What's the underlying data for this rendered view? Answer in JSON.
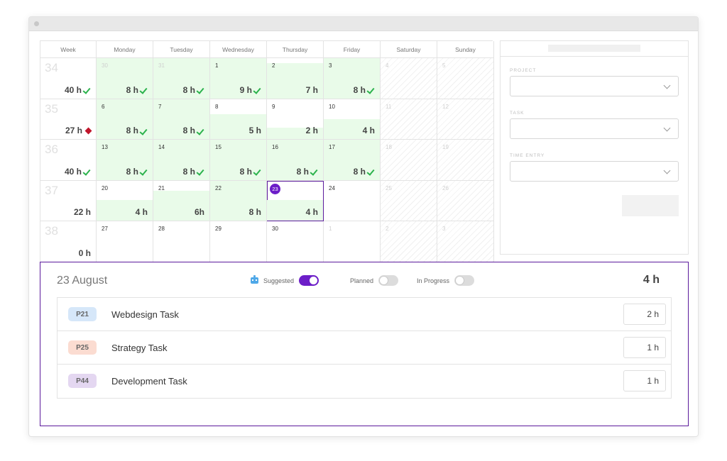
{
  "calendar": {
    "headers": [
      "Week",
      "Monday",
      "Tuesday",
      "Wednesday",
      "Thursday",
      "Friday",
      "Saturday",
      "Sunday"
    ],
    "weeks": [
      {
        "week": "34",
        "total": "40 h",
        "status": "ok",
        "days": [
          {
            "day": "30",
            "hours": "8 h",
            "check": true,
            "fill": 1.0,
            "faded": true
          },
          {
            "day": "31",
            "hours": "8 h",
            "check": true,
            "fill": 1.0,
            "faded": true
          },
          {
            "day": "1",
            "hours": "9 h",
            "check": true,
            "fill": 1.0
          },
          {
            "day": "2",
            "hours": "7 h",
            "check": false,
            "fill": 0.88
          },
          {
            "day": "3",
            "hours": "8 h",
            "check": true,
            "fill": 1.0
          },
          {
            "day": "4",
            "weekend": true,
            "faded": true
          },
          {
            "day": "5",
            "weekend": true,
            "faded": true
          }
        ]
      },
      {
        "week": "35",
        "total": "27 h",
        "status": "warn",
        "days": [
          {
            "day": "6",
            "hours": "8 h",
            "check": true,
            "fill": 1.0
          },
          {
            "day": "7",
            "hours": "8 h",
            "check": true,
            "fill": 1.0
          },
          {
            "day": "8",
            "hours": "5 h",
            "check": false,
            "fill": 0.62
          },
          {
            "day": "9",
            "hours": "2 h",
            "check": false,
            "fill": 0.28
          },
          {
            "day": "10",
            "hours": "4 h",
            "check": false,
            "fill": 0.5
          },
          {
            "day": "11",
            "weekend": true,
            "faded": true
          },
          {
            "day": "12",
            "weekend": true,
            "faded": true
          }
        ]
      },
      {
        "week": "36",
        "total": "40 h",
        "status": "ok",
        "days": [
          {
            "day": "13",
            "hours": "8 h",
            "check": true,
            "fill": 1.0
          },
          {
            "day": "14",
            "hours": "8 h",
            "check": true,
            "fill": 1.0
          },
          {
            "day": "15",
            "hours": "8 h",
            "check": true,
            "fill": 1.0
          },
          {
            "day": "16",
            "hours": "8 h",
            "check": true,
            "fill": 1.0
          },
          {
            "day": "17",
            "hours": "8 h",
            "check": true,
            "fill": 1.0
          },
          {
            "day": "18",
            "weekend": true,
            "faded": true
          },
          {
            "day": "19",
            "weekend": true,
            "faded": true
          }
        ]
      },
      {
        "week": "37",
        "total": "22 h",
        "status": "none",
        "days": [
          {
            "day": "20",
            "hours": "4 h",
            "check": false,
            "fill": 0.52
          },
          {
            "day": "21",
            "hours": "6h",
            "check": false,
            "fill": 0.75
          },
          {
            "day": "22",
            "hours": "8 h",
            "check": false,
            "fill": 1.0
          },
          {
            "day": "23",
            "hours": "4 h",
            "check": false,
            "fill": 0.52,
            "today": true
          },
          {
            "day": "24"
          },
          {
            "day": "25",
            "weekend": true,
            "faded": true
          },
          {
            "day": "26",
            "weekend": true,
            "faded": true
          }
        ]
      },
      {
        "week": "38",
        "total": "0 h",
        "status": "none",
        "days": [
          {
            "day": "27"
          },
          {
            "day": "28"
          },
          {
            "day": "29"
          },
          {
            "day": "30"
          },
          {
            "day": "1",
            "faded": true
          },
          {
            "day": "2",
            "weekend": true,
            "faded": true
          },
          {
            "day": "3",
            "weekend": true,
            "faded": true
          }
        ]
      }
    ]
  },
  "side_panel": {
    "project_label": "PROJECT",
    "task_label": "TASK",
    "time_entry_label": "TIME ENTRY"
  },
  "detail": {
    "date": "23 August",
    "total": "4 h",
    "toggles": [
      {
        "label": "Suggested",
        "on": true,
        "icon": "robot-icon"
      },
      {
        "label": "Planned",
        "on": false
      },
      {
        "label": "In Progress",
        "on": false
      }
    ],
    "tasks": [
      {
        "tag": "P21",
        "tag_color": "#d6e7f9",
        "name": "Webdesign Task",
        "hours": "2 h"
      },
      {
        "tag": "P25",
        "tag_color": "#fbdcd1",
        "name": "Strategy Task",
        "hours": "1 h"
      },
      {
        "tag": "P44",
        "tag_color": "#e4d7f1",
        "name": "Development Task",
        "hours": "1 h"
      }
    ]
  },
  "colors": {
    "accent": "#6c1ec8",
    "fill_green": "#e9fbe9",
    "check_green": "#2bb24c",
    "warn_red": "#c0152b"
  }
}
